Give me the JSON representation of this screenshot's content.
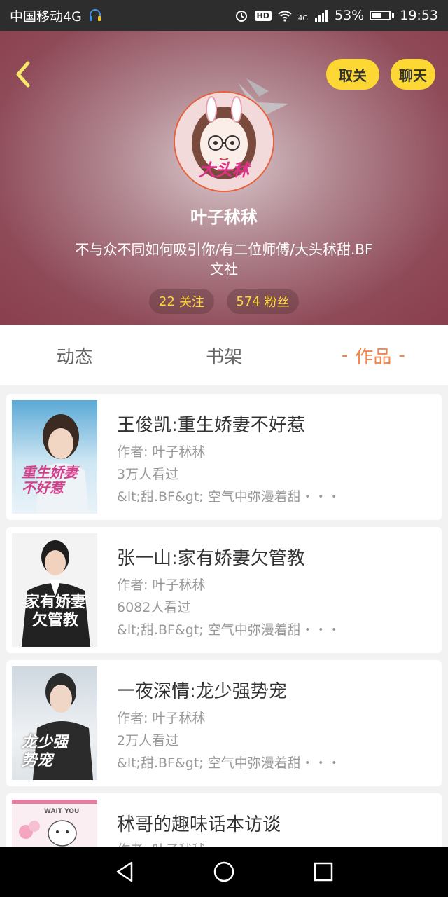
{
  "status_bar": {
    "carrier": "中国移动4G",
    "hd": "HD",
    "network": "4G",
    "battery_percent": "53%",
    "battery_level": 0.53,
    "time": "19:53"
  },
  "header": {
    "unfollow_label": "取关",
    "chat_label": "聊天",
    "avatar_text": "大头秫",
    "nickname": "叶子秫秫",
    "bio": "不与众不同如何吸引你/有二位师傅/大头秫甜.BF文社",
    "following_count": "22",
    "following_label": "关注",
    "fans_count": "574",
    "fans_label": "粉丝"
  },
  "tabs": [
    {
      "label": "动态",
      "active": false
    },
    {
      "label": "书架",
      "active": false
    },
    {
      "label": "作品",
      "active": true
    }
  ],
  "works": [
    {
      "title": "王俊凯:重生娇妻不好惹",
      "author": "作者: 叶子秫秫",
      "views": "3万人看过",
      "desc": "&lt;甜.BF&gt; 空气中弥漫着甜・・・",
      "cover_text": "重生娇妻不好惹"
    },
    {
      "title": "张一山:家有娇妻欠管教",
      "author": "作者: 叶子秫秫",
      "views": "6082人看过",
      "desc": "&lt;甜.BF&gt; 空气中弥漫着甜・・・",
      "cover_text": "家有娇妻欠管教"
    },
    {
      "title": "一夜深情:龙少强势宠",
      "author": "作者: 叶子秫秫",
      "views": "2万人看过",
      "desc": "&lt;甜.BF&gt; 空气中弥漫着甜・・・",
      "cover_text": "龙少强势宠"
    },
    {
      "title": "秫哥的趣味话本访谈",
      "author": "作者: 叶子秫秫",
      "views": "",
      "desc": "",
      "cover_text": "WAIT YOU"
    }
  ],
  "colors": {
    "accent_yellow": "#fdd835",
    "active_tab": "#f0874e",
    "header_base": "#8f4a58"
  }
}
